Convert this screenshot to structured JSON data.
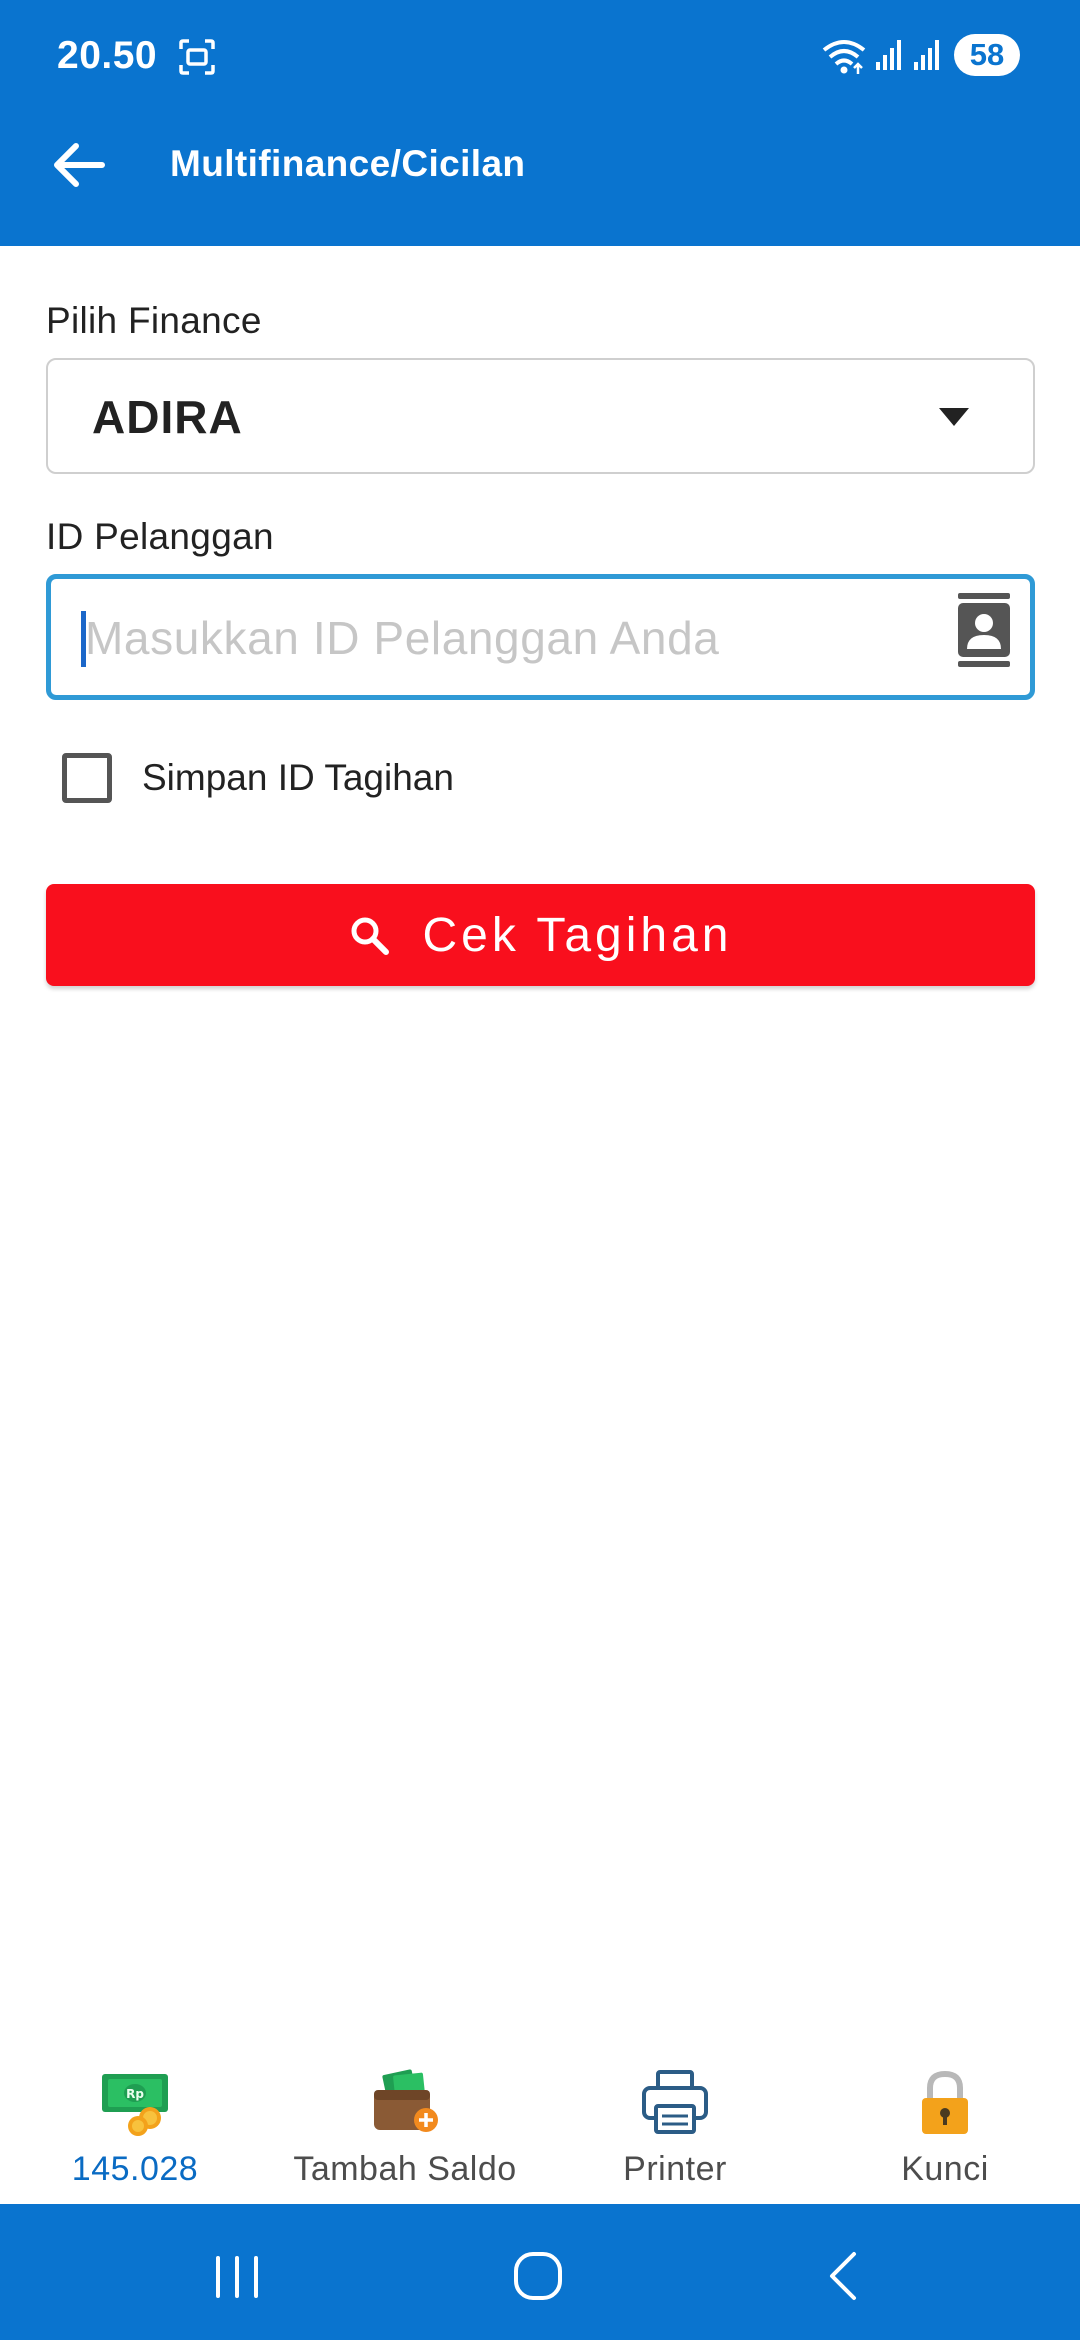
{
  "status_bar": {
    "time": "20.50",
    "battery": "58"
  },
  "app_bar": {
    "title": "Multifinance/Cicilan"
  },
  "form": {
    "finance_label": "Pilih Finance",
    "finance_selected": "ADIRA",
    "customer_id_label": "ID Pelanggan",
    "customer_id_placeholder": "Masukkan ID Pelanggan Anda",
    "customer_id_value": "",
    "save_id_label": "Simpan ID Tagihan",
    "save_id_checked": false,
    "submit_label": "Cek Tagihan"
  },
  "bottom_nav": {
    "items": [
      {
        "label": "145.028",
        "icon": "money-coins-icon"
      },
      {
        "label": "Tambah Saldo",
        "icon": "wallet-add-icon"
      },
      {
        "label": "Printer",
        "icon": "printer-icon"
      },
      {
        "label": "Kunci",
        "icon": "lock-icon"
      }
    ]
  },
  "colors": {
    "primary": "#0a74cf",
    "accent_red": "#f90f1d",
    "input_focus": "#2f9ad6"
  }
}
